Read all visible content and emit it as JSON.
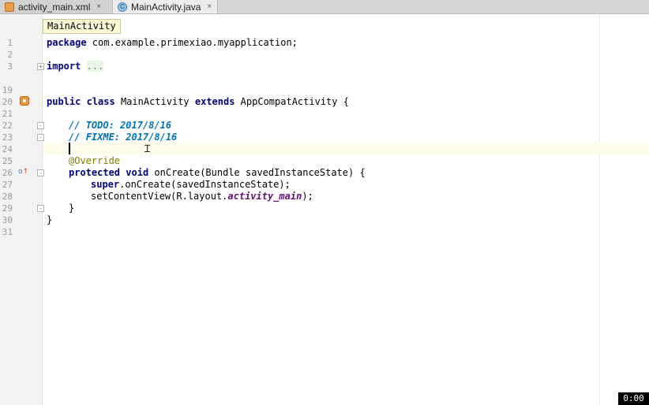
{
  "tabs": [
    {
      "label": "activity_main.xml",
      "icon": "xml-file-icon",
      "close": "×"
    },
    {
      "label": "MainActivity.java",
      "icon": "java-class-icon",
      "icon_glyph": "C",
      "close": "×",
      "active": true
    }
  ],
  "breadcrumb": "MainActivity",
  "line_numbers": [
    "1",
    "2",
    "3",
    "19",
    "20",
    "21",
    "22",
    "23",
    "24",
    "25",
    "26",
    "27",
    "28",
    "29",
    "30",
    "31"
  ],
  "code": {
    "l1_kw": "package",
    "l1_rest": " com.example.primexiao.myapplication;",
    "l3_kw": "import",
    "l3_fold": "...",
    "l20_kw1": "public",
    "l20_kw2": "class",
    "l20_name": " MainActivity ",
    "l20_kw3": "extends",
    "l20_rest": " AppCompatActivity {",
    "l22_slash": "// ",
    "l22_todo": "TODO: 2017/8/16",
    "l23_slash": "// ",
    "l23_fixme": "FIXME: 2017/8/16",
    "l25_anno": "@Override",
    "l26_kw1": "protected",
    "l26_kw2": "void",
    "l26_rest": " onCreate(Bundle savedInstanceState) {",
    "l27_kw": "super",
    "l27_rest": ".onCreate(savedInstanceState);",
    "l28_a": "setContentView(R.layout.",
    "l28_field": "activity_main",
    "l28_b": ");",
    "l29": "}",
    "l30": "}"
  },
  "timer": "0:00",
  "colors": {
    "keyword": "#000080",
    "todo": "#0073bf",
    "annotation": "#808000",
    "field": "#660e7a",
    "current_line": "#fdfcea"
  }
}
